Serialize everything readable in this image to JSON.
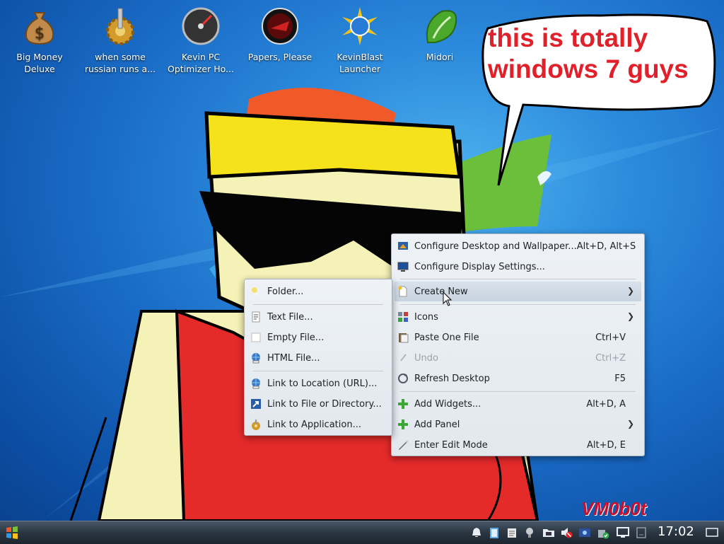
{
  "desktop_icons": [
    {
      "label": "Big Money Deluxe",
      "icon": "money-bag-icon"
    },
    {
      "label": "when some russian runs a...",
      "icon": "gear-icon"
    },
    {
      "label": "Kevin PC Optimizer Ho...",
      "icon": "speedometer-icon"
    },
    {
      "label": "Papers, Please",
      "icon": "stamp-emblem-icon"
    },
    {
      "label": "KevinBlast Launcher",
      "icon": "starburst-icon"
    },
    {
      "label": "Midori",
      "icon": "leaf-icon"
    }
  ],
  "speech_bubble": {
    "line1": "this is totally",
    "line2": "windows 7 guys"
  },
  "signature": "VM0b0t",
  "context_menu": {
    "items": [
      {
        "label": "Configure Desktop and Wallpaper...",
        "shortcut": "Alt+D, Alt+S",
        "icon": "desktop-config-icon"
      },
      {
        "label": "Configure Display Settings...",
        "shortcut": "",
        "icon": "monitor-icon"
      },
      {
        "label": "Create New",
        "shortcut": "",
        "icon": "new-document-icon",
        "submenu": true,
        "highlighted": true
      },
      {
        "label": "Icons",
        "shortcut": "",
        "icon": "icons-grid-icon",
        "submenu": true
      },
      {
        "label": "Paste One File",
        "shortcut": "Ctrl+V",
        "icon": "paste-icon"
      },
      {
        "label": "Undo",
        "shortcut": "Ctrl+Z",
        "icon": "undo-icon",
        "disabled": true
      },
      {
        "label": "Refresh Desktop",
        "shortcut": "F5",
        "icon": "refresh-icon"
      },
      {
        "label": "Add Widgets...",
        "shortcut": "Alt+D, A",
        "icon": "plus-icon"
      },
      {
        "label": "Add Panel",
        "shortcut": "",
        "icon": "plus-icon",
        "submenu": true
      },
      {
        "label": "Enter Edit Mode",
        "shortcut": "Alt+D, E",
        "icon": "edit-icon"
      }
    ]
  },
  "create_new_submenu": {
    "items": [
      {
        "label": "Folder...",
        "icon": "folder-icon"
      },
      {
        "label": "Text File...",
        "icon": "text-file-icon"
      },
      {
        "label": "Empty File...",
        "icon": "empty-file-icon"
      },
      {
        "label": "HTML File...",
        "icon": "html-file-icon"
      },
      {
        "label": "Link to Location (URL)...",
        "icon": "globe-link-icon"
      },
      {
        "label": "Link to File or Directory...",
        "icon": "link-arrow-icon"
      },
      {
        "label": "Link to Application...",
        "icon": "application-link-icon"
      }
    ]
  },
  "taskbar": {
    "clock": "17:02",
    "tray_icons": [
      "notification-bell-icon",
      "clipboard-icon",
      "notes-icon",
      "bulb-icon",
      "folder-icon",
      "volume-muted-icon",
      "network-card-icon",
      "updates-icon",
      "display-icon",
      "drive-icon",
      "show-desktop-icon"
    ]
  },
  "colors": {
    "bubble_text": "#e0202a",
    "menu_highlight": "#c7d3df",
    "taskbar": "#2c3844"
  }
}
